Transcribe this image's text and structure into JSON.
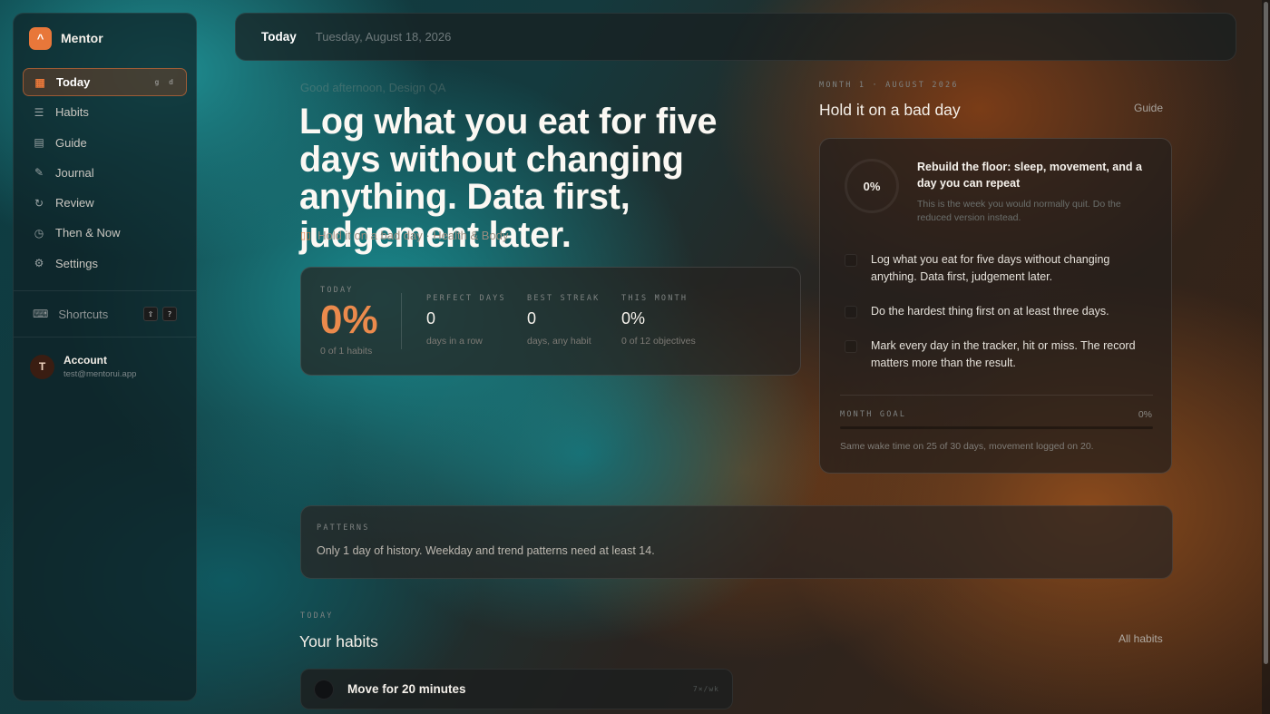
{
  "brand": {
    "name": "Mentor",
    "logo_glyph": "^",
    "accent": "#e8773a"
  },
  "sidebar": {
    "items": [
      {
        "label": "Today",
        "icon": "grid-icon",
        "glyph": "▦",
        "shortcut": "g d",
        "active": true
      },
      {
        "label": "Habits",
        "icon": "checklist-icon",
        "glyph": "☰"
      },
      {
        "label": "Guide",
        "icon": "calendar-icon",
        "glyph": "▤"
      },
      {
        "label": "Journal",
        "icon": "notebook-icon",
        "glyph": "✎"
      },
      {
        "label": "Review",
        "icon": "refresh-icon",
        "glyph": "↻"
      },
      {
        "label": "Then & Now",
        "icon": "history-icon",
        "glyph": "◷"
      },
      {
        "label": "Settings",
        "icon": "gear-icon",
        "glyph": "⚙"
      }
    ],
    "shortcuts": {
      "label": "Shortcuts",
      "keys": [
        "⇧",
        "?"
      ]
    },
    "account": {
      "initial": "T",
      "name": "Account",
      "email": "test@mentorui.app"
    }
  },
  "topbar": {
    "title": "Today",
    "date": "Tuesday, August 18, 2026"
  },
  "hero": {
    "greeting": "Good afternoon, Design QA",
    "title": "Log what you eat for five days without changing anything. Data first, judgement later.",
    "meta": "Hold it on a bad day · Health & Body"
  },
  "stats": {
    "today": {
      "label": "TODAY",
      "value": "0%",
      "sub": "0 of 1 habits",
      "progress": 0
    },
    "perfect_days": {
      "label": "PERFECT DAYS",
      "value": "0",
      "sub": "days in a row"
    },
    "best_streak": {
      "label": "BEST STREAK",
      "value": "0",
      "sub": "days, any habit"
    },
    "this_month": {
      "label": "THIS MONTH",
      "value": "0%",
      "sub": "0 of 12 objectives"
    }
  },
  "month": {
    "eyebrow": "MONTH 1 · AUGUST 2026",
    "title": "Hold it on a bad day",
    "guide_label": "Guide",
    "ring_value": "0%",
    "focus_title": "Rebuild the floor: sleep, movement, and a day you can repeat",
    "focus_sub": "This is the week you would normally quit. Do the reduced version instead.",
    "objectives": [
      {
        "text": "Log what you eat for five days without changing anything. Data first, judgement later.",
        "done": false
      },
      {
        "text": "Do the hardest thing first on at least three days.",
        "done": false
      },
      {
        "text": "Mark every day in the tracker, hit or miss. The record matters more than the result.",
        "done": false
      }
    ],
    "goal_label": "MONTH GOAL",
    "goal_value": "0%",
    "goal_progress": 0,
    "goal_desc": "Same wake time on 25 of 30 days, movement logged on 20."
  },
  "patterns": {
    "label": "PATTERNS",
    "text": "Only 1 day of history. Weekday and trend patterns need at least 14."
  },
  "habits": {
    "eyebrow": "TODAY",
    "title": "Your habits",
    "all_label": "All habits",
    "items": [
      {
        "name": "Move for 20 minutes",
        "count": "7×/wk",
        "done": false
      }
    ]
  }
}
